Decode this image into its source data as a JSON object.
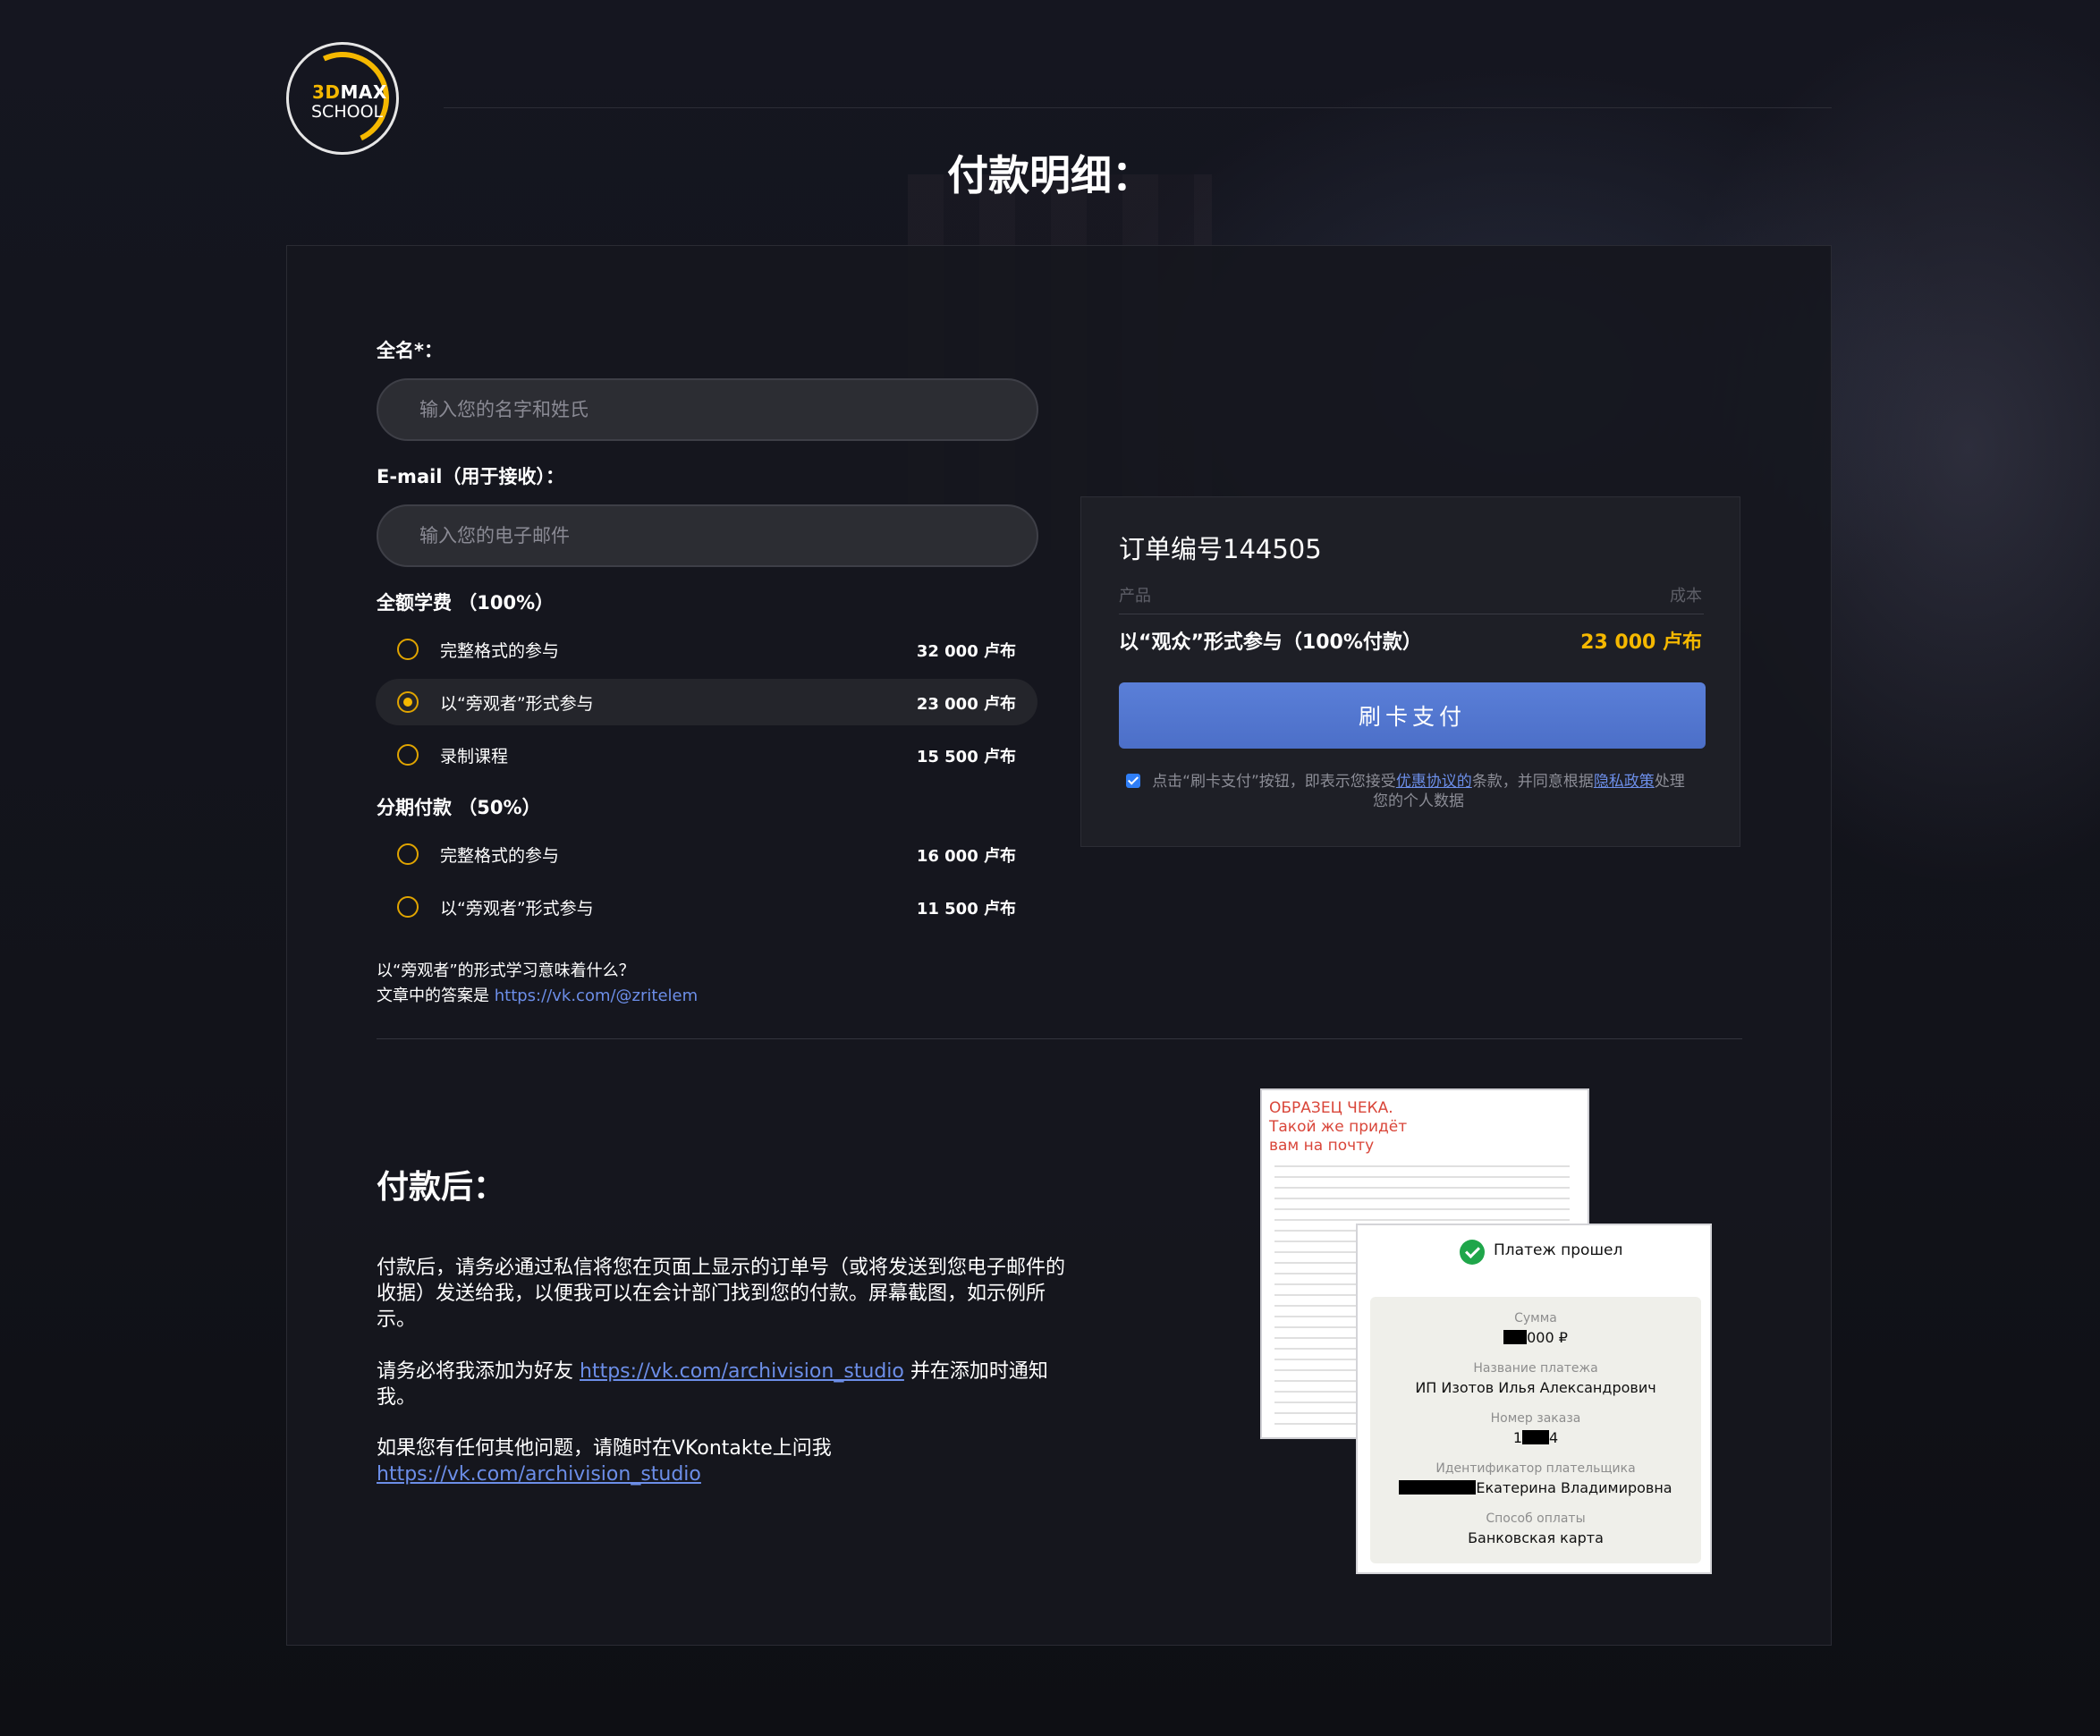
{
  "logo": {
    "line1_a": "3D",
    "line1_b": "MAX",
    "line2": "SCHOOL"
  },
  "page_title": "付款明细：",
  "form": {
    "name_label": "全名*：",
    "name_placeholder": "输入您的名字和姓氏",
    "email_label": "E-mail（用于接收）：",
    "email_placeholder": "输入您的电子邮件",
    "full_section": "全额学费 （100%）",
    "full_options": [
      {
        "label": "完整格式的参与",
        "price": "32 000 卢布",
        "selected": false
      },
      {
        "label": "以“旁观者”形式参与",
        "price": "23 000 卢布",
        "selected": true
      },
      {
        "label": "录制课程",
        "price": "15 500 卢布",
        "selected": false
      }
    ],
    "install_section": "分期付款 （50%）",
    "install_options": [
      {
        "label": "完整格式的参与",
        "price": "16 000 卢布",
        "selected": false
      },
      {
        "label": "以“旁观者”形式参与",
        "price": "11 500 卢布",
        "selected": false
      }
    ],
    "note_q": "以“旁观者”的形式学习意味着什么？",
    "note_a": "文章中的答案是 ",
    "note_link": "https://vk.com/@zritelem"
  },
  "order": {
    "title": "订单编号144505",
    "col_product": "产品",
    "col_cost": "成本",
    "product": "以“观众”形式参与（100%付款）",
    "price": "23 000 卢布",
    "pay_button": "刷卡支付",
    "consent_a": "点击“刷卡支付”按钮，即表示您接受",
    "consent_link1": "优惠协议的",
    "consent_b": "条款，并同意根据",
    "consent_link2": "隐私政策",
    "consent_c": "处理您的个人数据"
  },
  "after": {
    "title": "付款后：",
    "p1": "付款后，请务必通过私信将您在页面上显示的订单号（或将发送到您电子邮件的收据）发送给我，以便我可以在会计部门找到您的付款。屏幕截图，如示例所示。",
    "p2_a": "请务必将我添加为好友 ",
    "p2_link": "https://vk.com/archivision_studio",
    "p2_b": " 并在添加时通知我。",
    "p3_a": "如果您有任何其他问题，请随时在VKontakte上问我",
    "p3_link": "https://vk.com/archivision_studio"
  },
  "receipt_sample": {
    "red_text_1": "ОБРАЗЕЦ ЧЕКА.",
    "red_text_2": "Такой же придёт",
    "red_text_3": "вам на почту"
  },
  "receipt_app": {
    "status": "Платеж прошел",
    "sum_caption": "Сумма",
    "sum_value": "000 ₽",
    "name_caption": "Название платежа",
    "name_value": "ИП Изотов Илья Александрович",
    "order_caption": "Номер заказа",
    "order_value_a": "1",
    "order_value_b": "4",
    "payer_caption": "Идентификатор плательщика",
    "payer_value": "Екатерина Владимировна",
    "method_caption": "Способ оплаты",
    "method_value": "Банковская карта"
  },
  "colors": {
    "accent": "#f5b800",
    "button": "#5a7fd8",
    "link": "#6c8ee8",
    "background": "#0f1016"
  }
}
